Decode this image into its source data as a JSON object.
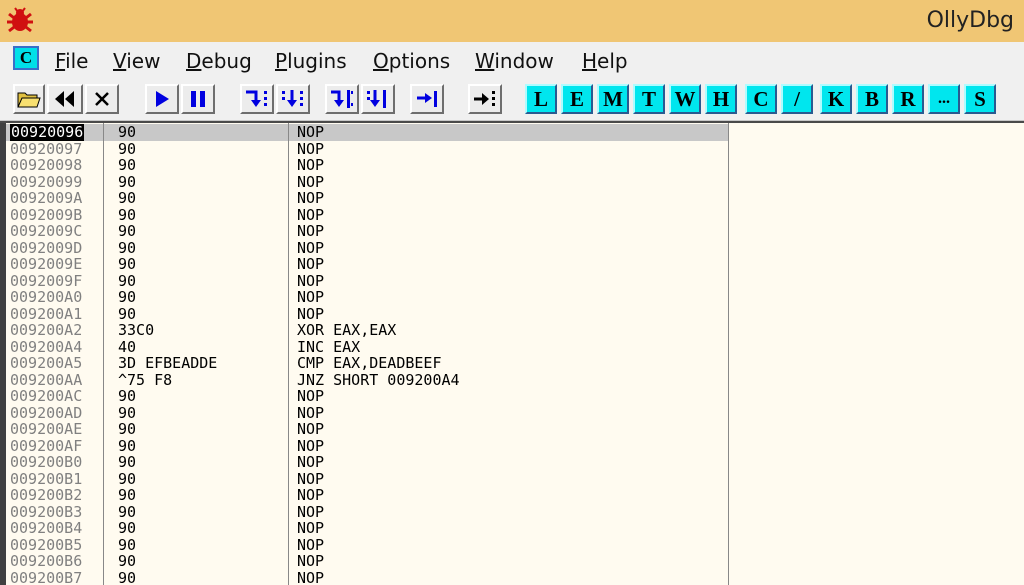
{
  "window": {
    "title": "OllyDbg",
    "icon": "ladybug-icon"
  },
  "menu": {
    "c_box": "C",
    "items": [
      "File",
      "View",
      "Debug",
      "Plugins",
      "Options",
      "Window",
      "Help"
    ]
  },
  "toolbar": {
    "buttons": [
      "open-icon",
      "restart-icon",
      "close-icon",
      "run-icon",
      "pause-icon",
      "step-into-icon",
      "step-over-icon",
      "trace-into-icon",
      "trace-over-icon",
      "execute-till-return-icon",
      "go-to-icon"
    ],
    "letters": [
      "L",
      "E",
      "M",
      "T",
      "W",
      "H",
      "C",
      "/",
      "K",
      "B",
      "R",
      "...",
      "S"
    ]
  },
  "disassembly": {
    "rows": [
      {
        "addr": "00920096",
        "hex": "90",
        "asm": "NOP",
        "selected": true
      },
      {
        "addr": "00920097",
        "hex": "90",
        "asm": "NOP"
      },
      {
        "addr": "00920098",
        "hex": "90",
        "asm": "NOP"
      },
      {
        "addr": "00920099",
        "hex": "90",
        "asm": "NOP"
      },
      {
        "addr": "0092009A",
        "hex": "90",
        "asm": "NOP"
      },
      {
        "addr": "0092009B",
        "hex": "90",
        "asm": "NOP"
      },
      {
        "addr": "0092009C",
        "hex": "90",
        "asm": "NOP"
      },
      {
        "addr": "0092009D",
        "hex": "90",
        "asm": "NOP"
      },
      {
        "addr": "0092009E",
        "hex": "90",
        "asm": "NOP"
      },
      {
        "addr": "0092009F",
        "hex": "90",
        "asm": "NOP"
      },
      {
        "addr": "009200A0",
        "hex": "90",
        "asm": "NOP"
      },
      {
        "addr": "009200A1",
        "hex": "90",
        "asm": "NOP"
      },
      {
        "addr": "009200A2",
        "hex": "33C0",
        "asm": "XOR EAX,EAX"
      },
      {
        "addr": "009200A4",
        "hex": "40",
        "asm": "INC EAX"
      },
      {
        "addr": "009200A5",
        "hex": "3D EFBEADDE",
        "asm": "CMP EAX,DEADBEEF"
      },
      {
        "addr": "009200AA",
        "hex": "^75 F8",
        "asm": "JNZ SHORT 009200A4"
      },
      {
        "addr": "009200AC",
        "hex": "90",
        "asm": "NOP"
      },
      {
        "addr": "009200AD",
        "hex": "90",
        "asm": "NOP"
      },
      {
        "addr": "009200AE",
        "hex": "90",
        "asm": "NOP"
      },
      {
        "addr": "009200AF",
        "hex": "90",
        "asm": "NOP"
      },
      {
        "addr": "009200B0",
        "hex": "90",
        "asm": "NOP"
      },
      {
        "addr": "009200B1",
        "hex": "90",
        "asm": "NOP"
      },
      {
        "addr": "009200B2",
        "hex": "90",
        "asm": "NOP"
      },
      {
        "addr": "009200B3",
        "hex": "90",
        "asm": "NOP"
      },
      {
        "addr": "009200B4",
        "hex": "90",
        "asm": "NOP"
      },
      {
        "addr": "009200B5",
        "hex": "90",
        "asm": "NOP"
      },
      {
        "addr": "009200B6",
        "hex": "90",
        "asm": "NOP"
      },
      {
        "addr": "009200B7",
        "hex": "90",
        "asm": "NOP"
      }
    ]
  },
  "colors": {
    "title_bar": "#f0c674",
    "letter_button": "#00e6ee",
    "toolbar_icon_blue": "#0000e0",
    "pane_background": "#fffbf0"
  }
}
